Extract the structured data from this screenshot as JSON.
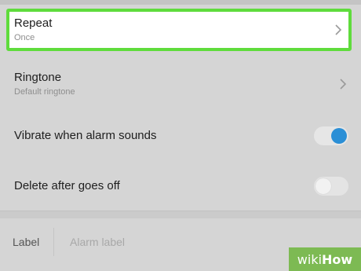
{
  "settings": {
    "repeat": {
      "title": "Repeat",
      "value": "Once"
    },
    "ringtone": {
      "title": "Ringtone",
      "value": "Default ringtone"
    },
    "vibrate": {
      "title": "Vibrate when alarm sounds",
      "enabled": true
    },
    "delete_after": {
      "title": "Delete after goes off",
      "enabled": false
    }
  },
  "label": {
    "title": "Label",
    "placeholder": "Alarm label"
  },
  "watermark": {
    "part1": "wiki",
    "part2": "How"
  },
  "colors": {
    "highlight": "#5fdc3c",
    "toggle_on": "#2b8fd6",
    "watermark_bg": "#7dba53"
  }
}
